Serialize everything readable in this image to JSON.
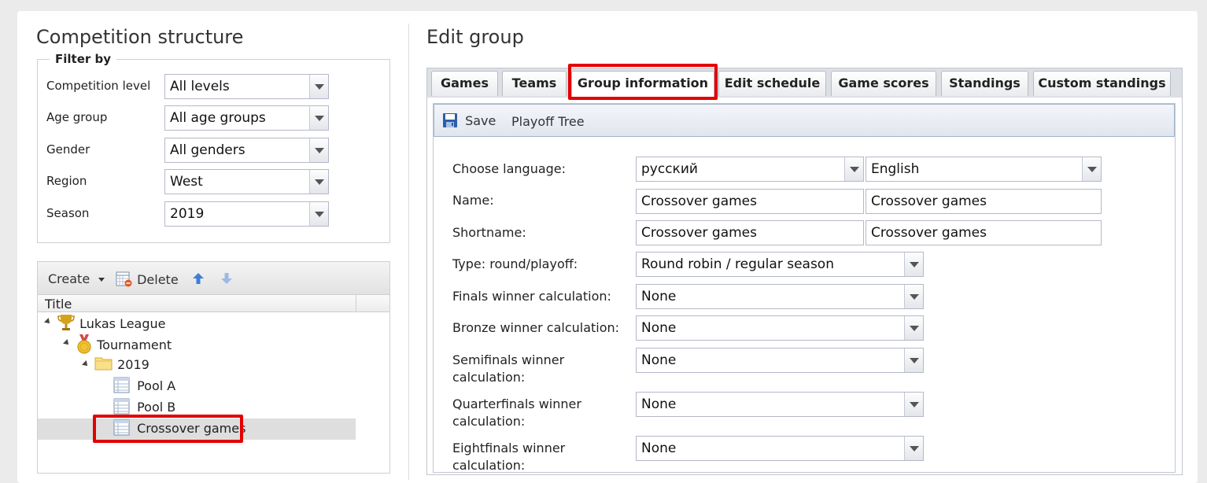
{
  "left": {
    "title": "Competition structure",
    "filter": {
      "legend": "Filter by",
      "fields": [
        {
          "label": "Competition level",
          "value": "All levels"
        },
        {
          "label": "Age group",
          "value": "All age groups"
        },
        {
          "label": "Gender",
          "value": "All genders"
        },
        {
          "label": "Region",
          "value": "West"
        },
        {
          "label": "Season",
          "value": "2019"
        }
      ]
    },
    "toolbar": {
      "create": "Create",
      "delete": "Delete"
    },
    "tree_header": "Title",
    "tree": {
      "league": "Lukas League",
      "tournament": "Tournament",
      "season": "2019",
      "groups": [
        "Pool A",
        "Pool B",
        "Crossover games"
      ]
    }
  },
  "right": {
    "title": "Edit group",
    "tabs": [
      "Games",
      "Teams",
      "Group information",
      "Edit schedule",
      "Game scores",
      "Standings",
      "Custom standings"
    ],
    "active_tab": "Group information",
    "toolbar": {
      "save": "Save",
      "playoff_tree": "Playoff Tree"
    },
    "form": {
      "choose_language": {
        "label": "Choose language:",
        "lang1": "русский",
        "lang2": "English"
      },
      "name": {
        "label": "Name:",
        "value1": "Crossover games",
        "value2": "Crossover games"
      },
      "shortname": {
        "label": "Shortname:",
        "value1": "Crossover games",
        "value2": "Crossover games"
      },
      "type": {
        "label": "Type: round/playoff:",
        "value": "Round robin / regular season"
      },
      "finals": {
        "label": "Finals winner calculation:",
        "value": "None"
      },
      "bronze": {
        "label": "Bronze winner calculation:",
        "value": "None"
      },
      "semifinals": {
        "label_1": "Semifinals winner",
        "label_2": "calculation:",
        "value": "None"
      },
      "quarterfinals": {
        "label_1": "Quarterfinals winner",
        "label_2": "calculation:",
        "value": "None"
      },
      "eightfinals": {
        "label_1": "Eightfinals winner",
        "label_2": "calculation:",
        "value": "None"
      }
    }
  },
  "colors": {
    "highlight": "#e30000",
    "selected_row": "#dedede",
    "toolbar_border": "#9fb3cc"
  }
}
